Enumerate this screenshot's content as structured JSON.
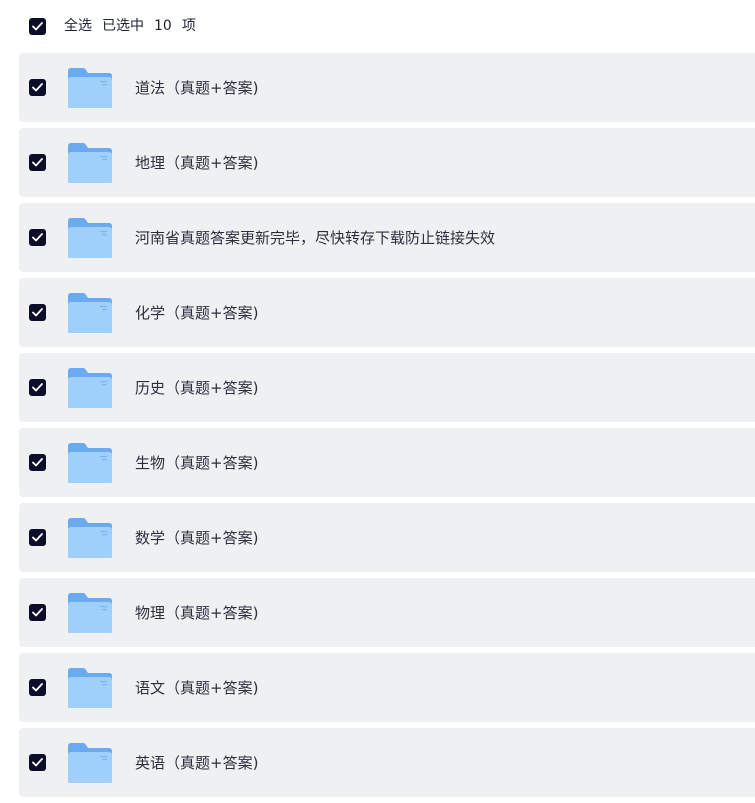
{
  "header": {
    "select_all_label": "全选",
    "selected_prefix": "已选中",
    "selected_count": "10",
    "selected_suffix": "项",
    "checked": true
  },
  "files": [
    {
      "name": "道法（真题+答案)",
      "icon": "folder-icon",
      "checked": true
    },
    {
      "name": "地理（真题+答案)",
      "icon": "folder-icon",
      "checked": true
    },
    {
      "name": "河南省真题答案更新完毕，尽快转存下载防止链接失效",
      "icon": "folder-icon",
      "checked": true
    },
    {
      "name": "化学（真题+答案)",
      "icon": "folder-icon",
      "checked": true
    },
    {
      "name": "历史（真题+答案)",
      "icon": "folder-icon",
      "checked": true
    },
    {
      "name": "生物（真题+答案)",
      "icon": "folder-icon",
      "checked": true
    },
    {
      "name": "数学（真题+答案)",
      "icon": "folder-icon",
      "checked": true
    },
    {
      "name": "物理（真题+答案)",
      "icon": "folder-icon",
      "checked": true
    },
    {
      "name": "语文（真题+答案)",
      "icon": "folder-icon",
      "checked": true
    },
    {
      "name": "英语（真题+答案)",
      "icon": "folder-icon",
      "checked": true
    }
  ],
  "colors": {
    "checkbox": "#0b0d2a",
    "row_background": "#eff0f2",
    "folder_back": "#6aaaf0",
    "folder_front": "#9fcffb"
  }
}
